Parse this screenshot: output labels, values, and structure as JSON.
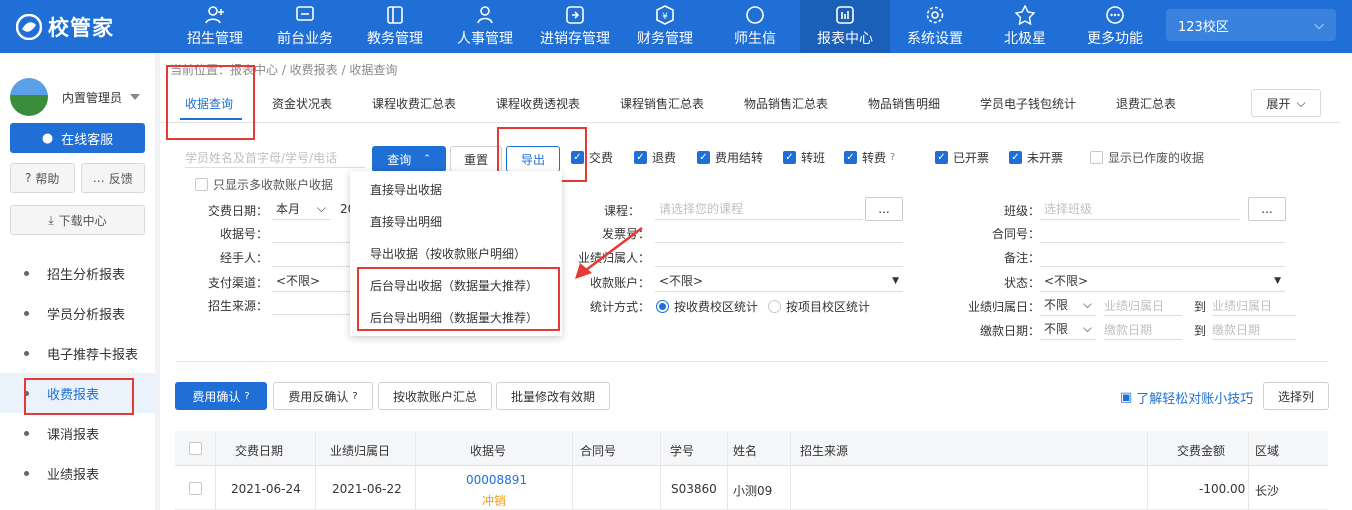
{
  "app": {
    "logo_text": "校管家",
    "campus": "123校区"
  },
  "nav": [
    {
      "label": "招生管理",
      "icon": "user-add-icon"
    },
    {
      "label": "前台业务",
      "icon": "monitor-icon"
    },
    {
      "label": "教务管理",
      "icon": "book-icon"
    },
    {
      "label": "人事管理",
      "icon": "person-icon"
    },
    {
      "label": "进销存管理",
      "icon": "inventory-icon"
    },
    {
      "label": "财务管理",
      "icon": "yen-icon"
    },
    {
      "label": "师生信",
      "icon": "message-icon"
    },
    {
      "label": "报表中心",
      "icon": "report-icon"
    },
    {
      "label": "系统设置",
      "icon": "gear-icon"
    },
    {
      "label": "北极星",
      "icon": "star-icon"
    },
    {
      "label": "更多功能",
      "icon": "more-icon"
    }
  ],
  "sidebar": {
    "user": "内置管理员",
    "service": "在线客服",
    "help": "帮助",
    "feedback": "反馈",
    "download": "下载中心",
    "items": [
      "招生分析报表",
      "学员分析报表",
      "电子推荐卡报表",
      "收费报表",
      "课消报表",
      "业绩报表"
    ]
  },
  "breadcrumb": "当前位置：报表中心 / 收费报表 / 收据查询",
  "tabs": [
    "收据查询",
    "资金状况表",
    "课程收费汇总表",
    "课程收费透视表",
    "课程销售汇总表",
    "物品销售汇总表",
    "物品销售明细",
    "学员电子钱包统计",
    "退费汇总表"
  ],
  "expand_label": "展开",
  "search": {
    "placeholder": "学员姓名及首字母/学号/电话",
    "query": "查询",
    "reset": "重置",
    "export": "导出"
  },
  "checks": [
    {
      "label": "交费",
      "on": true
    },
    {
      "label": "退费",
      "on": true
    },
    {
      "label": "费用结转",
      "on": true
    },
    {
      "label": "转班",
      "on": true
    },
    {
      "label": "转费",
      "on": true
    },
    {
      "label": "已开票",
      "on": true
    },
    {
      "label": "未开票",
      "on": true
    },
    {
      "label": "显示已作废的收据",
      "on": false
    },
    {
      "label": "只显示多收款账户收据",
      "on": false
    }
  ],
  "export_menu": [
    "直接导出收据",
    "直接导出明细",
    "导出收据（按收款账户明细）",
    "后台导出收据（数据量大推荐）",
    "后台导出明细（数据量大推荐）"
  ],
  "filters": {
    "pay_date": "交费日期：",
    "pay_date_val": "本月",
    "pay_date_extra": "20",
    "receipt_no": "收据号：",
    "handler": "经手人：",
    "channel": "支付渠道：",
    "channel_val": "<不限>",
    "source": "招生来源：",
    "course": "课程：",
    "course_ph": "请选择您的课程",
    "invoice": "发票号：",
    "perf_person": "业绩归属人：",
    "account": "收款账户：",
    "account_val": "<不限>",
    "stat": "统计方式：",
    "stat_opt1": "按收费校区统计",
    "stat_opt2": "按项目校区统计",
    "class": "班级：",
    "class_ph": "选择班级",
    "contract": "合同号：",
    "remark": "备注：",
    "status": "状态：",
    "status_val": "<不限>",
    "perf_date": "业绩归属日：",
    "perf_date_val": "不限",
    "perf_date_ph": "业绩归属日",
    "to": "到",
    "pay_day": "缴款日期：",
    "pay_day_val": "不限",
    "pay_day_ph": "缴款日期",
    "more": "..."
  },
  "actions": {
    "confirm": "费用确认",
    "unconfirm": "费用反确认",
    "by_account": "按收款账户汇总",
    "batch": "批量修改有效期",
    "tip": "了解轻松对账小技巧",
    "columns": "选择列"
  },
  "table": {
    "headers": [
      "交费日期",
      "业绩归属日",
      "收据号",
      "合同号",
      "学号",
      "姓名",
      "招生来源",
      "交费金额",
      "区域"
    ],
    "rows": [
      {
        "pay_date": "2021-06-24",
        "perf_date": "2021-06-22",
        "receipt": "00008891",
        "tag": "冲销",
        "contract": "",
        "sno": "S03860",
        "name": "小测09",
        "source": "",
        "amount": "-100.00",
        "area": "长沙"
      }
    ]
  },
  "colors": {
    "primary": "#1f6fd6",
    "highlight": "#e53935"
  }
}
